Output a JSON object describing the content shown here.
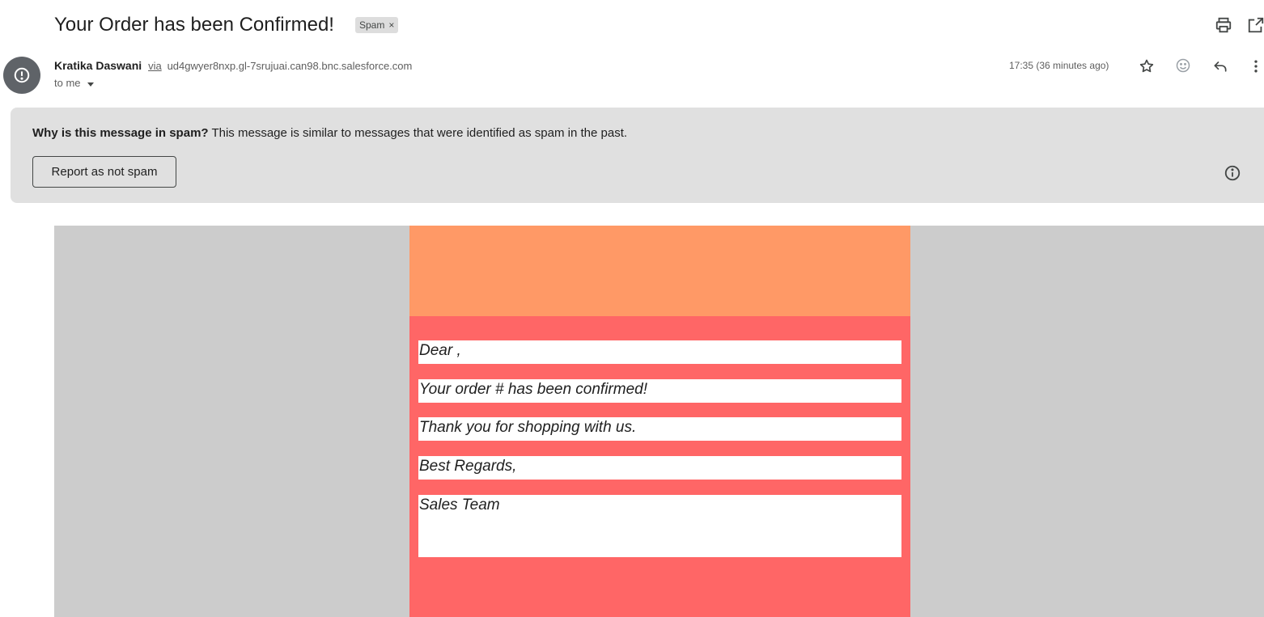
{
  "email": {
    "subject": "Your Order has been Confirmed!",
    "label": "Spam",
    "label_remove": "×",
    "sender_name": "Kratika Daswani",
    "via_label": "via",
    "via_domain": "ud4gwyer8nxp.gl-7srujuai.can98.bnc.salesforce.com",
    "recipient": "to me",
    "timestamp": "17:35 (36 minutes ago)"
  },
  "spam_banner": {
    "question": "Why is this message in spam?",
    "explanation": " This message is similar to messages that were identified as spam in the past.",
    "report_button": "Report as not spam"
  },
  "body": {
    "lines": [
      "Dear ,",
      "Your order # has been confirmed!",
      "Thank you for shopping with us.",
      "Best Regards,",
      "Sales Team"
    ]
  },
  "icons": {
    "print": "print-icon",
    "open_new_window": "open-in-new-window-icon",
    "sender_avatar": "spam-warning-icon",
    "star": "star-icon",
    "emoji": "emoji-reaction-icon",
    "reply": "reply-icon",
    "more": "more-vertical-icon",
    "info": "info-icon"
  },
  "colors": {
    "banner_background": "#e0e0e0",
    "email_outer_background": "#cccccc",
    "email_header_band": "#ff9966",
    "email_body_background": "#ff6666",
    "avatar": "#5f6368"
  }
}
